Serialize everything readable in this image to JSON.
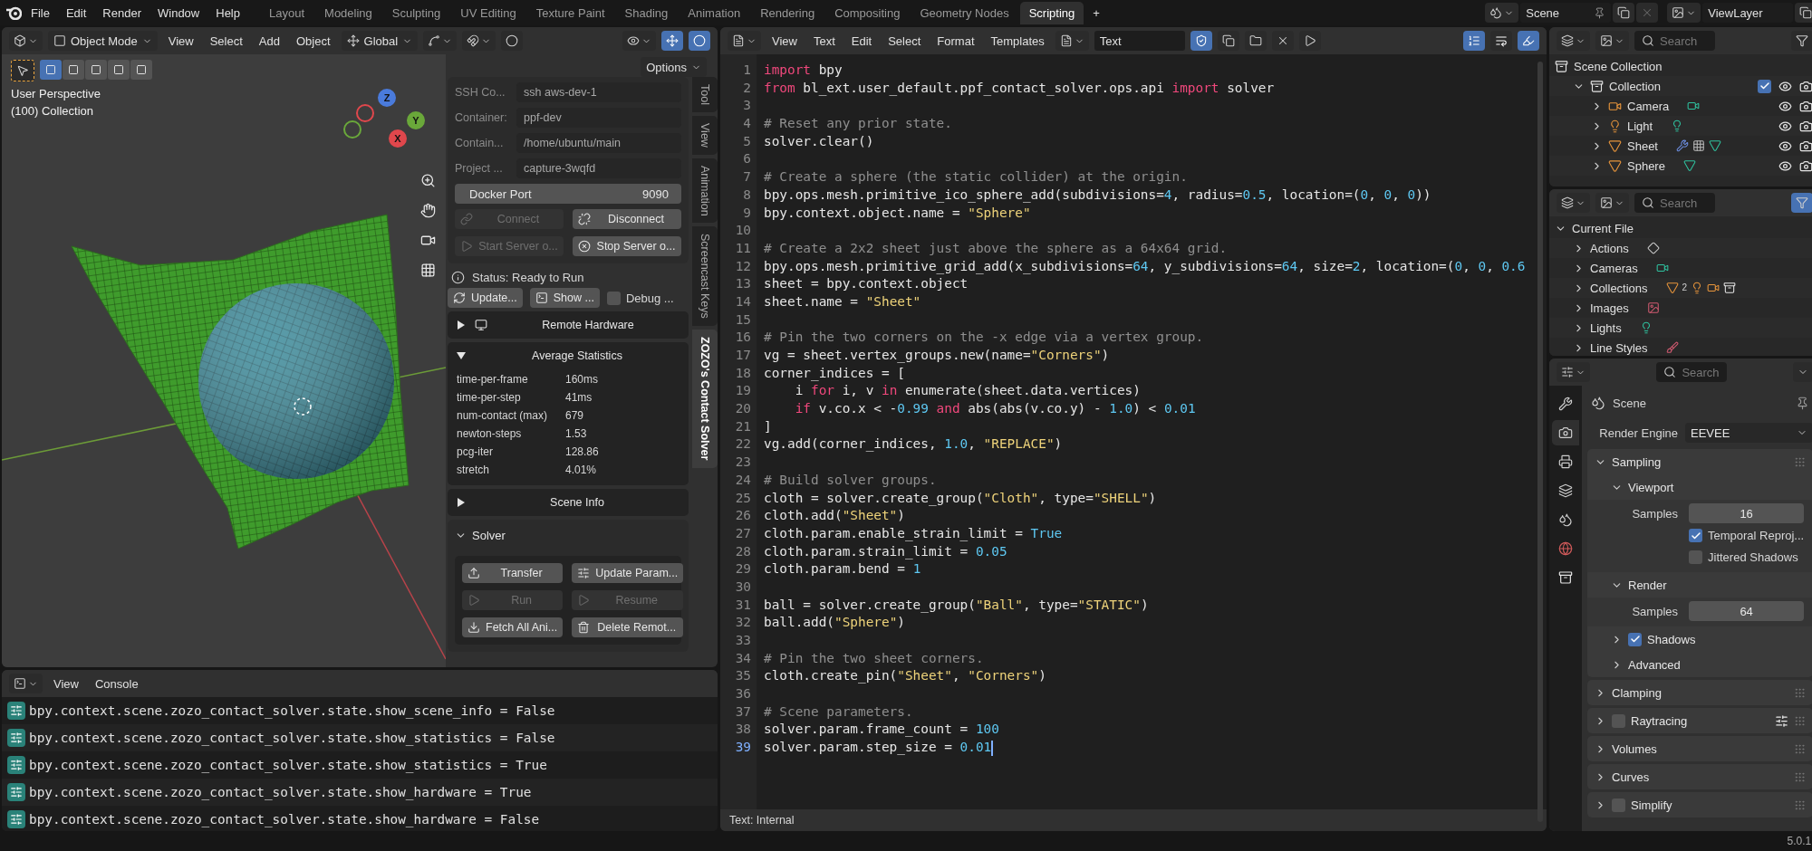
{
  "topbar": {
    "menus": [
      "File",
      "Edit",
      "Render",
      "Window",
      "Help"
    ],
    "workspaces": [
      {
        "label": "Layout",
        "selected": false
      },
      {
        "label": "Modeling",
        "selected": false
      },
      {
        "label": "Sculpting",
        "selected": false
      },
      {
        "label": "UV Editing",
        "selected": false
      },
      {
        "label": "Texture Paint",
        "selected": false
      },
      {
        "label": "Shading",
        "selected": false
      },
      {
        "label": "Animation",
        "selected": false
      },
      {
        "label": "Rendering",
        "selected": false
      },
      {
        "label": "Compositing",
        "selected": false
      },
      {
        "label": "Geometry Nodes",
        "selected": false
      },
      {
        "label": "Scripting",
        "selected": true
      }
    ],
    "add_workspace": "+",
    "scene": "Scene",
    "view_layer": "ViewLayer"
  },
  "viewport": {
    "mode": "Object Mode",
    "menus": [
      "View",
      "Select",
      "Add",
      "Object"
    ],
    "orientation": "Global",
    "options": "Options",
    "gizmos_on": true,
    "overlays_on": true,
    "select_modes": [
      {
        "selected": true
      },
      {
        "selected": false
      },
      {
        "selected": false
      },
      {
        "selected": false
      },
      {
        "selected": false
      }
    ],
    "overlay_text": [
      "User Perspective",
      "(100) Collection"
    ],
    "axes": [
      {
        "kind": "z",
        "label": "Z"
      },
      {
        "kind": "y",
        "label": "Y"
      },
      {
        "kind": "x",
        "label": "X"
      }
    ],
    "sidebar_tabs": [
      {
        "label": "Tool",
        "selected": false
      },
      {
        "label": "View",
        "selected": false
      },
      {
        "label": "Animation",
        "selected": false
      },
      {
        "label": "Screencast Keys",
        "selected": false
      },
      {
        "label": "ZOZO's Contact Solver",
        "selected": true
      }
    ]
  },
  "solver_panel": {
    "fields": [
      {
        "label": "SSH Co...",
        "value": "ssh aws-dev-1",
        "disabled": true
      },
      {
        "label": "Container:",
        "value": "ppf-dev",
        "disabled": true
      },
      {
        "label": "Contain...",
        "value": "/home/ubuntu/main",
        "disabled": true
      },
      {
        "label": "Project ...",
        "value": "capture-3wqfd",
        "disabled": true
      }
    ],
    "docker_port": {
      "label": "Docker Port",
      "value": "9090"
    },
    "connection_buttons": [
      {
        "label": "Connect",
        "kind": "link",
        "disabled": true
      },
      {
        "label": "Disconnect",
        "kind": "unlink",
        "disabled": false
      },
      {
        "label": "Start Server o...",
        "kind": "play",
        "disabled": true
      },
      {
        "label": "Stop Server o...",
        "kind": "stop",
        "disabled": false
      }
    ],
    "status": "Status: Ready to Run",
    "actions": [
      {
        "kind": "refresh",
        "label": "Update..."
      },
      {
        "kind": "terminal",
        "label": "Show ..."
      },
      {
        "kind": "checkbox",
        "label": "Debug ...",
        "checked": false
      }
    ],
    "sections": [
      {
        "title": "Remote Hardware",
        "kind": "hardware",
        "expanded": false
      },
      {
        "title": "Average Statistics",
        "expanded": true,
        "stats": [
          {
            "name": "time-per-frame",
            "value": "160ms"
          },
          {
            "name": "time-per-step",
            "value": "41ms"
          },
          {
            "name": "num-contact (max)",
            "value": "679"
          },
          {
            "name": "newton-steps",
            "value": "1.53"
          },
          {
            "name": "pcg-iter",
            "value": "128.86"
          },
          {
            "name": "stretch",
            "value": "4.01%"
          }
        ]
      },
      {
        "title": "Scene Info",
        "expanded": false
      }
    ]
  },
  "solver": {
    "title": "Solver",
    "expanded": true,
    "buttons": [
      {
        "label": "Transfer",
        "kind": "upload",
        "disabled": false
      },
      {
        "label": "Update Param...",
        "kind": "sliders",
        "disabled": false
      },
      {
        "label": "Run",
        "kind": "play",
        "disabled": true
      },
      {
        "label": "Resume",
        "kind": "play",
        "disabled": true
      },
      {
        "label": "Fetch All Ani...",
        "kind": "download",
        "disabled": false
      },
      {
        "label": "Delete Remot...",
        "kind": "trash",
        "disabled": false
      }
    ]
  },
  "console": {
    "menus": [
      "View",
      "Console"
    ],
    "lines": [
      "bpy.context.scene.zozo_contact_solver.state.show_scene_info = False",
      "bpy.context.scene.zozo_contact_solver.state.show_statistics = False",
      "bpy.context.scene.zozo_contact_solver.state.show_statistics = True",
      "bpy.context.scene.zozo_contact_solver.state.show_hardware = True",
      "bpy.context.scene.zozo_contact_solver.state.show_hardware = False"
    ]
  },
  "text_editor": {
    "menus": [
      "View",
      "Text",
      "Edit",
      "Select",
      "Format",
      "Templates"
    ],
    "datablock": "Text",
    "fake_user": true,
    "line_numbers": true,
    "word_wrap": false,
    "syntax_highlight": true,
    "footer": "Text: Internal",
    "lines": [
      {
        "n": "1",
        "current": false,
        "tokens": [
          {
            "kind": "keyword",
            "text": "import"
          },
          {
            "kind": "plain",
            "text": " bpy"
          }
        ]
      },
      {
        "n": "2",
        "current": false,
        "tokens": [
          {
            "kind": "keyword",
            "text": "from"
          },
          {
            "kind": "plain",
            "text": " bl_ext.user_default.ppf_contact_solver.ops.api "
          },
          {
            "kind": "keyword",
            "text": "import"
          },
          {
            "kind": "plain",
            "text": " solver"
          }
        ]
      },
      {
        "n": "3",
        "current": false
      },
      {
        "n": "4",
        "current": false,
        "tokens": [
          {
            "kind": "comment",
            "text": "# Reset any prior state."
          }
        ]
      },
      {
        "n": "5",
        "current": false,
        "tokens": [
          {
            "kind": "plain",
            "text": "solver.clear()"
          }
        ]
      },
      {
        "n": "6",
        "current": false
      },
      {
        "n": "7",
        "current": false,
        "tokens": [
          {
            "kind": "comment",
            "text": "# Create a sphere (the static collider) at the origin."
          }
        ]
      },
      {
        "n": "8",
        "current": false,
        "tokens": [
          {
            "kind": "plain",
            "text": "bpy.ops.mesh.primitive_ico_sphere_add(subdivisions="
          },
          {
            "kind": "number",
            "text": "4"
          },
          {
            "kind": "plain",
            "text": ", radius="
          },
          {
            "kind": "number",
            "text": "0.5"
          },
          {
            "kind": "plain",
            "text": ", location=("
          },
          {
            "kind": "number",
            "text": "0"
          },
          {
            "kind": "plain",
            "text": ", "
          },
          {
            "kind": "number",
            "text": "0"
          },
          {
            "kind": "plain",
            "text": ", "
          },
          {
            "kind": "number",
            "text": "0"
          },
          {
            "kind": "plain",
            "text": "))"
          }
        ]
      },
      {
        "n": "9",
        "current": false,
        "tokens": [
          {
            "kind": "plain",
            "text": "bpy.context.object.name = "
          },
          {
            "kind": "string",
            "text": "\"Sphere\""
          }
        ]
      },
      {
        "n": "10",
        "current": false
      },
      {
        "n": "11",
        "current": false,
        "tokens": [
          {
            "kind": "comment",
            "text": "# Create a 2x2 sheet just above the sphere as a 64x64 grid."
          }
        ]
      },
      {
        "n": "12",
        "current": false,
        "tokens": [
          {
            "kind": "plain",
            "text": "bpy.ops.mesh.primitive_grid_add(x_subdivisions="
          },
          {
            "kind": "number",
            "text": "64"
          },
          {
            "kind": "plain",
            "text": ", y_subdivisions="
          },
          {
            "kind": "number",
            "text": "64"
          },
          {
            "kind": "plain",
            "text": ", size="
          },
          {
            "kind": "number",
            "text": "2"
          },
          {
            "kind": "plain",
            "text": ", location=("
          },
          {
            "kind": "number",
            "text": "0"
          },
          {
            "kind": "plain",
            "text": ", "
          },
          {
            "kind": "number",
            "text": "0"
          },
          {
            "kind": "plain",
            "text": ", "
          },
          {
            "kind": "number",
            "text": "0.6"
          }
        ]
      },
      {
        "n": "13",
        "current": false,
        "tokens": [
          {
            "kind": "plain",
            "text": "sheet = bpy.context.object"
          }
        ]
      },
      {
        "n": "14",
        "current": false,
        "tokens": [
          {
            "kind": "plain",
            "text": "sheet.name = "
          },
          {
            "kind": "string",
            "text": "\"Sheet\""
          }
        ]
      },
      {
        "n": "15",
        "current": false
      },
      {
        "n": "16",
        "current": false,
        "tokens": [
          {
            "kind": "comment",
            "text": "# Pin the two corners on the -x edge via a vertex group."
          }
        ]
      },
      {
        "n": "17",
        "current": false,
        "tokens": [
          {
            "kind": "plain",
            "text": "vg = sheet.vertex_groups.new(name="
          },
          {
            "kind": "string",
            "text": "\"Corners\""
          },
          {
            "kind": "plain",
            "text": ")"
          }
        ]
      },
      {
        "n": "18",
        "current": false,
        "tokens": [
          {
            "kind": "plain",
            "text": "corner_indices = ["
          }
        ]
      },
      {
        "n": "19",
        "current": false,
        "tokens": [
          {
            "kind": "plain",
            "text": "    i "
          },
          {
            "kind": "keyword",
            "text": "for"
          },
          {
            "kind": "plain",
            "text": " i, v "
          },
          {
            "kind": "keyword",
            "text": "in"
          },
          {
            "kind": "plain",
            "text": " enumerate(sheet.data.vertices)"
          }
        ]
      },
      {
        "n": "20",
        "current": false,
        "tokens": [
          {
            "kind": "keyword",
            "text": "    if"
          },
          {
            "kind": "plain",
            "text": " v.co.x < -"
          },
          {
            "kind": "number",
            "text": "0.99"
          },
          {
            "kind": "keyword",
            "text": " and"
          },
          {
            "kind": "plain",
            "text": " abs(abs(v.co.y) - "
          },
          {
            "kind": "number",
            "text": "1.0"
          },
          {
            "kind": "plain",
            "text": ") < "
          },
          {
            "kind": "number",
            "text": "0.01"
          }
        ]
      },
      {
        "n": "21",
        "current": false,
        "tokens": [
          {
            "kind": "plain",
            "text": "]"
          }
        ]
      },
      {
        "n": "22",
        "current": false,
        "tokens": [
          {
            "kind": "plain",
            "text": "vg.add(corner_indices, "
          },
          {
            "kind": "number",
            "text": "1.0"
          },
          {
            "kind": "plain",
            "text": ", "
          },
          {
            "kind": "string",
            "text": "\"REPLACE\""
          },
          {
            "kind": "plain",
            "text": ")"
          }
        ]
      },
      {
        "n": "23",
        "current": false
      },
      {
        "n": "24",
        "current": false,
        "tokens": [
          {
            "kind": "comment",
            "text": "# Build solver groups."
          }
        ]
      },
      {
        "n": "25",
        "current": false,
        "tokens": [
          {
            "kind": "plain",
            "text": "cloth = solver.create_group("
          },
          {
            "kind": "string",
            "text": "\"Cloth\""
          },
          {
            "kind": "plain",
            "text": ", type="
          },
          {
            "kind": "string",
            "text": "\"SHELL\""
          },
          {
            "kind": "plain",
            "text": ")"
          }
        ]
      },
      {
        "n": "26",
        "current": false,
        "tokens": [
          {
            "kind": "plain",
            "text": "cloth.add("
          },
          {
            "kind": "string",
            "text": "\"Sheet\""
          },
          {
            "kind": "plain",
            "text": ")"
          }
        ]
      },
      {
        "n": "27",
        "current": false,
        "tokens": [
          {
            "kind": "plain",
            "text": "cloth.param.enable_strain_limit = "
          },
          {
            "kind": "number",
            "text": "True"
          }
        ]
      },
      {
        "n": "28",
        "current": false,
        "tokens": [
          {
            "kind": "plain",
            "text": "cloth.param.strain_limit = "
          },
          {
            "kind": "number",
            "text": "0.05"
          }
        ]
      },
      {
        "n": "29",
        "current": false,
        "tokens": [
          {
            "kind": "plain",
            "text": "cloth.param.bend = "
          },
          {
            "kind": "number",
            "text": "1"
          }
        ]
      },
      {
        "n": "30",
        "current": false
      },
      {
        "n": "31",
        "current": false,
        "tokens": [
          {
            "kind": "plain",
            "text": "ball = solver.create_group("
          },
          {
            "kind": "string",
            "text": "\"Ball\""
          },
          {
            "kind": "plain",
            "text": ", type="
          },
          {
            "kind": "string",
            "text": "\"STATIC\""
          },
          {
            "kind": "plain",
            "text": ")"
          }
        ]
      },
      {
        "n": "32",
        "current": false,
        "tokens": [
          {
            "kind": "plain",
            "text": "ball.add("
          },
          {
            "kind": "string",
            "text": "\"Sphere\""
          },
          {
            "kind": "plain",
            "text": ")"
          }
        ]
      },
      {
        "n": "33",
        "current": false
      },
      {
        "n": "34",
        "current": false,
        "tokens": [
          {
            "kind": "comment",
            "text": "# Pin the two sheet corners."
          }
        ]
      },
      {
        "n": "35",
        "current": false,
        "tokens": [
          {
            "kind": "plain",
            "text": "cloth.create_pin("
          },
          {
            "kind": "string",
            "text": "\"Sheet\""
          },
          {
            "kind": "plain",
            "text": ", "
          },
          {
            "kind": "string",
            "text": "\"Corners\""
          },
          {
            "kind": "plain",
            "text": ")"
          }
        ]
      },
      {
        "n": "36",
        "current": false
      },
      {
        "n": "37",
        "current": false,
        "tokens": [
          {
            "kind": "comment",
            "text": "# Scene parameters."
          }
        ]
      },
      {
        "n": "38",
        "current": false,
        "tokens": [
          {
            "kind": "plain",
            "text": "solver.param.frame_count = "
          },
          {
            "kind": "number",
            "text": "100"
          }
        ]
      },
      {
        "n": "39",
        "current": true,
        "tokens": [
          {
            "kind": "plain",
            "text": "solver.param.step_size = "
          },
          {
            "kind": "number",
            "text": "0.01"
          }
        ]
      }
    ]
  },
  "outliner": {
    "search_placeholder": "Search",
    "tree": [
      {
        "label": "Scene Collection",
        "kind": "collection",
        "children": [
          {
            "label": "Collection",
            "kind": "collection",
            "expanded": true,
            "checked": true,
            "toggles": true,
            "children": [
              {
                "label": "Camera",
                "kind": "camera",
                "expanded": false,
                "toggles": true,
                "extras": [
                  {
                    "kind": "camera-data"
                  }
                ]
              },
              {
                "label": "Light",
                "kind": "light",
                "expanded": false,
                "toggles": true,
                "extras": [
                  {
                    "kind": "light-data"
                  }
                ]
              },
              {
                "label": "Sheet",
                "kind": "mesh",
                "expanded": false,
                "toggles": true,
                "extras": [
                  {
                    "kind": "modifier"
                  },
                  {
                    "kind": "vertex-groups"
                  },
                  {
                    "kind": "mesh-data"
                  }
                ]
              },
              {
                "label": "Sphere",
                "kind": "mesh",
                "expanded": false,
                "toggles": true,
                "extras": [
                  {
                    "kind": "mesh-data"
                  }
                ]
              }
            ]
          }
        ]
      }
    ]
  },
  "blender_file": {
    "search_placeholder": "Search",
    "tree": [
      {
        "label": "Current File",
        "expanded": true,
        "children": [
          {
            "label": "Actions",
            "expanded": false,
            "extras": [
              {
                "kind": "action"
              }
            ]
          },
          {
            "label": "Cameras",
            "expanded": false,
            "extras": [
              {
                "kind": "camera-data"
              }
            ]
          },
          {
            "label": "Collections",
            "expanded": false,
            "extras": [
              {
                "kind": "mesh",
                "count": "2"
              },
              {
                "kind": "light"
              },
              {
                "kind": "camera"
              },
              {
                "kind": "collection"
              }
            ]
          },
          {
            "label": "Images",
            "expanded": false,
            "extras": [
              {
                "kind": "image"
              }
            ]
          },
          {
            "label": "Lights",
            "expanded": false,
            "extras": [
              {
                "kind": "light-data"
              }
            ]
          },
          {
            "label": "Line Styles",
            "expanded": false,
            "extras": [
              {
                "kind": "linestyle"
              }
            ]
          }
        ]
      }
    ]
  },
  "properties": {
    "search_placeholder": "Search",
    "context": "Scene",
    "tabs": [
      {
        "kind": "tool",
        "selected": false
      },
      {
        "kind": "render",
        "selected": true
      },
      {
        "kind": "output",
        "selected": false
      },
      {
        "kind": "view-layer",
        "selected": false
      },
      {
        "kind": "scene",
        "selected": false
      },
      {
        "kind": "world",
        "selected": false
      },
      {
        "kind": "collection",
        "selected": false
      }
    ],
    "render_engine": {
      "label": "Render Engine",
      "value": "EEVEE"
    },
    "panels": [
      {
        "title": "Sampling",
        "expanded": true,
        "subpanels": [
          {
            "title": "Viewport",
            "expanded": true,
            "rows": [
              {
                "kind": "number",
                "label": "Samples",
                "value": "16"
              },
              {
                "kind": "checkbox",
                "label": "Temporal Reproj...",
                "checked": true
              },
              {
                "kind": "checkbox",
                "label": "Jittered Shadows",
                "checked": false
              }
            ]
          },
          {
            "title": "Render",
            "expanded": true,
            "rows": [
              {
                "kind": "number",
                "label": "Samples",
                "value": "64"
              }
            ]
          },
          {
            "title": "Shadows",
            "expanded": false,
            "checked": true
          },
          {
            "title": "Advanced",
            "expanded": false
          }
        ]
      },
      {
        "title": "Clamping",
        "expanded": false
      },
      {
        "title": "Raytracing",
        "expanded": false,
        "checked": false,
        "options": true
      },
      {
        "title": "Volumes",
        "expanded": false
      },
      {
        "title": "Curves",
        "expanded": false
      },
      {
        "title": "Simplify",
        "expanded": false,
        "checked": false
      }
    ]
  },
  "status_bar": {
    "version": "5.0.1"
  }
}
